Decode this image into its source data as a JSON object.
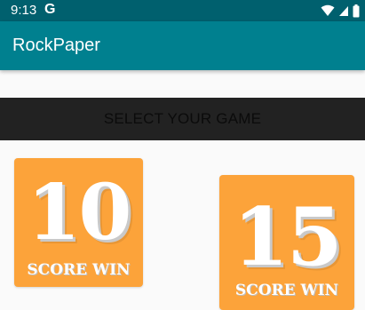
{
  "status_bar": {
    "time": "9:13",
    "notification_letter": "G",
    "icons": [
      "wifi-icon",
      "signal-icon",
      "battery-icon"
    ]
  },
  "app_bar": {
    "title": "RockPaper"
  },
  "banner": {
    "text": "SELECT YOUR GAME"
  },
  "games": [
    {
      "number": "10",
      "caption": "SCORE WIN"
    },
    {
      "number": "15",
      "caption": "SCORE WIN"
    }
  ],
  "colors": {
    "status_bar": "#00606e",
    "app_bar": "#00808f",
    "banner": "#222222",
    "card": "#fca33a"
  }
}
